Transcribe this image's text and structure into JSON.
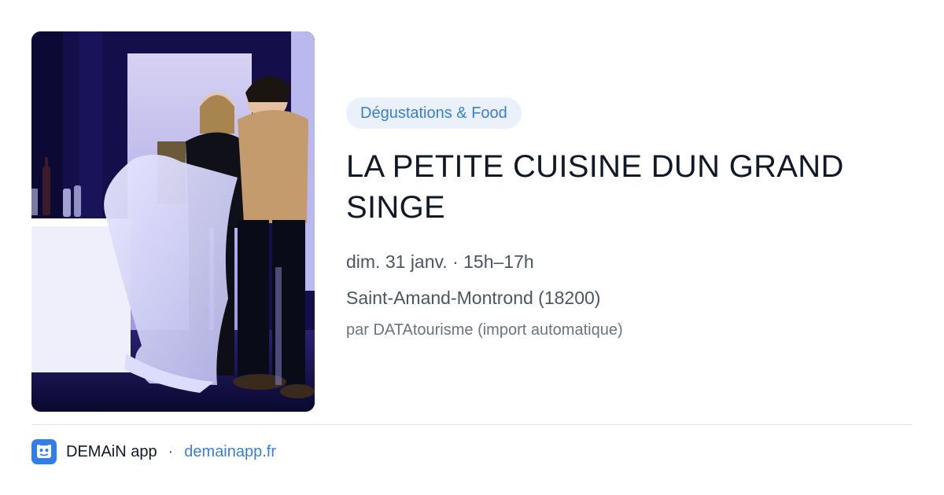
{
  "photo": {
    "alt_subject": "stage-photo",
    "colors": {
      "backdrop": "#1c1560",
      "stage_light": "#cfd0f5"
    }
  },
  "event": {
    "category": "Dégustations & Food",
    "title": "LA PETITE CUISINE DUN GRAND SINGE",
    "date_time": "dim. 31 janv. · 15h–17h",
    "location": "Saint-Amand-Montrond (18200)",
    "source": "par DATAtourisme (import automatique)"
  },
  "footer": {
    "app_icon": "demain-app-icon",
    "app_name": "DEMAiN app",
    "separator": "·",
    "link": "demainapp.fr"
  },
  "colors": {
    "accent": "#3a7fd5",
    "badge_bg": "#eaf1fb",
    "title": "#111827",
    "muted": "#4b5563"
  }
}
